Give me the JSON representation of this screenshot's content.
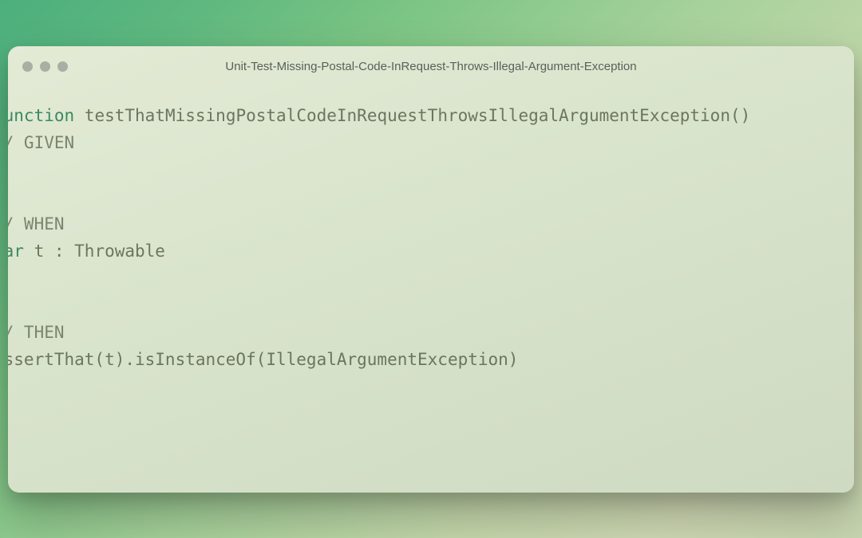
{
  "window": {
    "title": "Unit-Test-Missing-Postal-Code-InRequest-Throws-Illegal-Argument-Exception"
  },
  "code": {
    "keyword_function": "function",
    "fn_name": "testThatMissingPostalCodeInRequestThrowsIllegalArgumentException",
    "parens": "()",
    "comment_given": "// GIVEN",
    "ellipsis1": "…",
    "comment_when": "// WHEN",
    "keyword_var": "var",
    "var_decl": " t : Throwable",
    "ellipsis2": "…",
    "comment_then": "// THEN",
    "assert_line": "assertThat(t).isInstanceOf(IllegalArgumentException)",
    "ellipsis3": "…"
  }
}
